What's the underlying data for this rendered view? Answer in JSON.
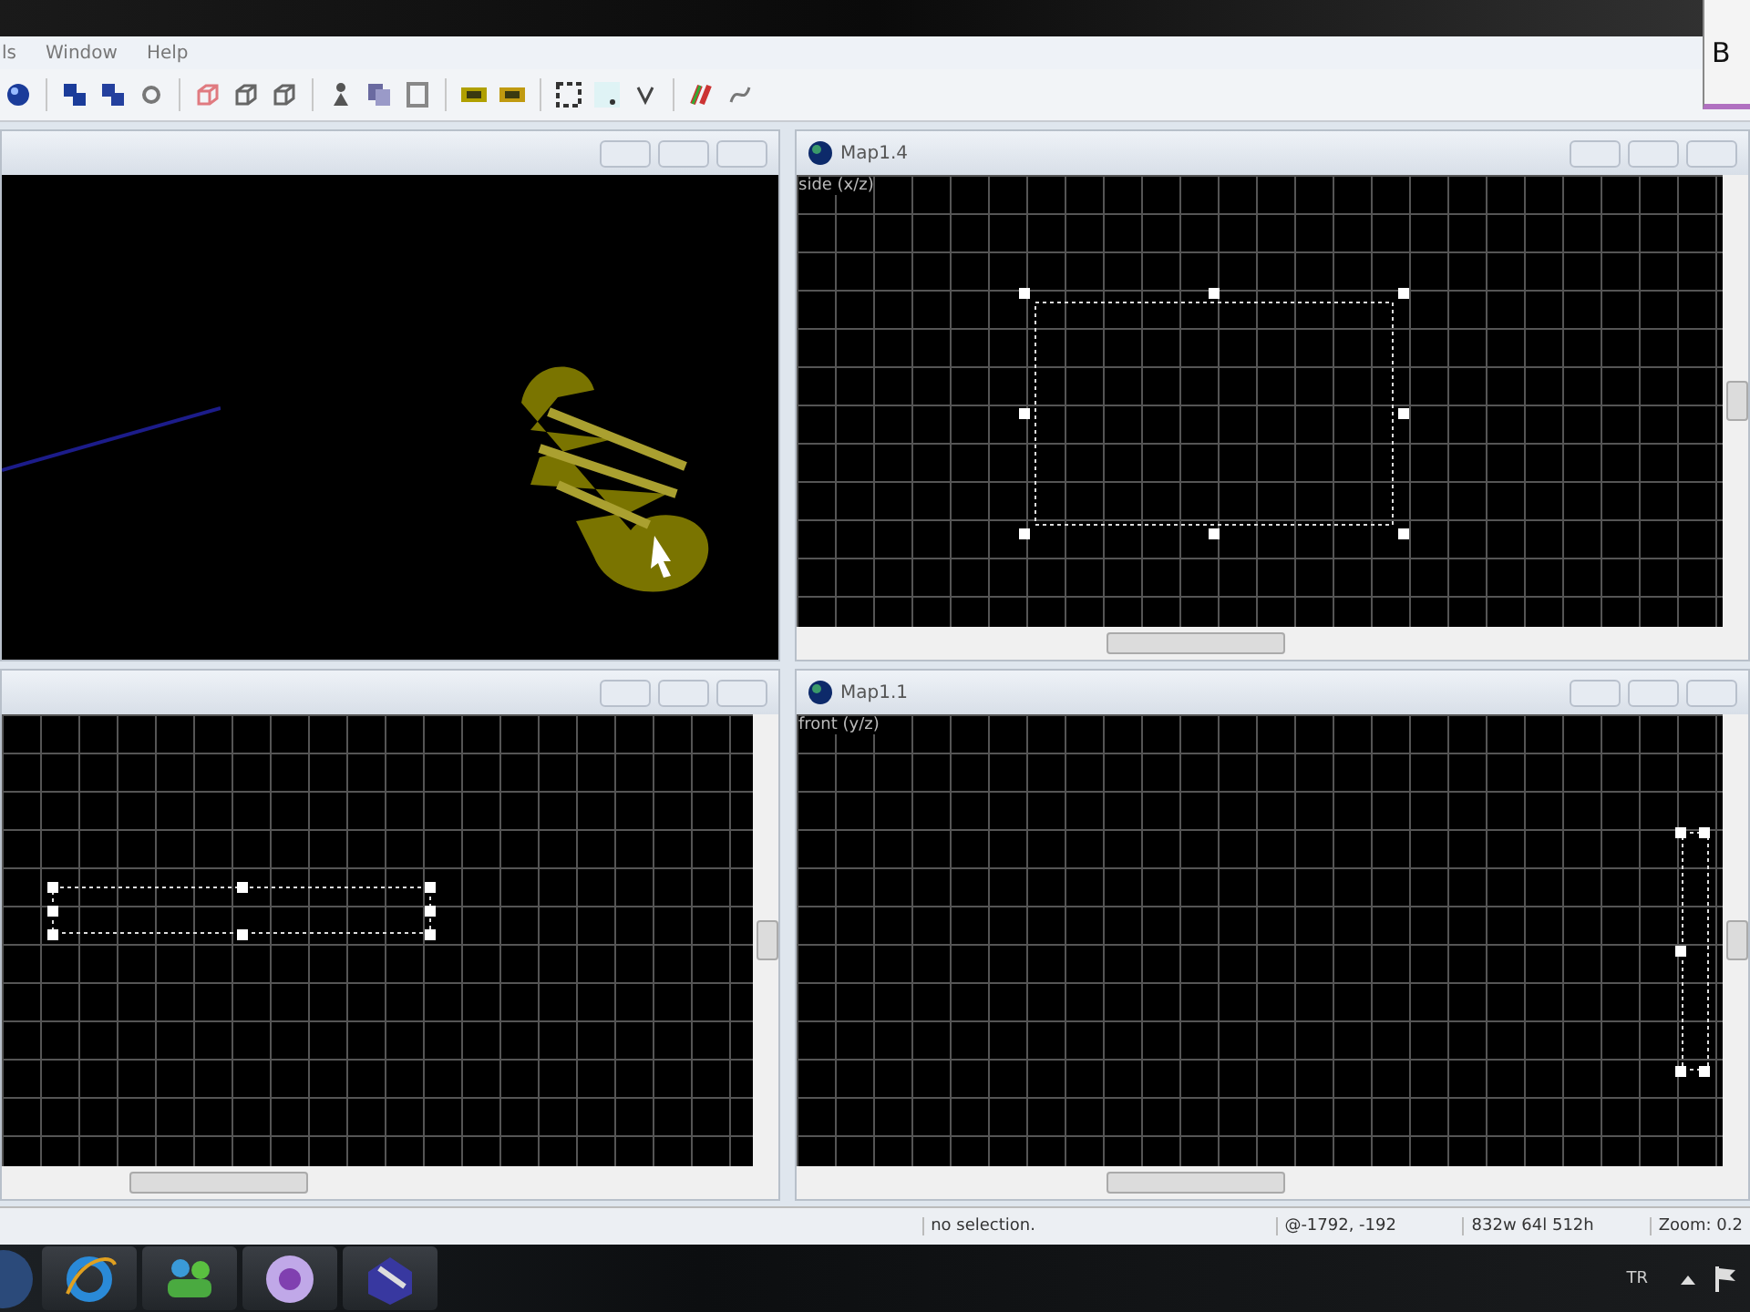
{
  "popup": {
    "text": "B"
  },
  "menu": [
    "ls",
    "Window",
    "Help"
  ],
  "viewports": [
    {
      "kind": "camera"
    },
    {
      "kind": "grid",
      "title": "Map1.4",
      "label": "side (x/z)"
    },
    {
      "kind": "grid"
    },
    {
      "kind": "grid",
      "title": "Map1.1",
      "label": "front (y/z)"
    }
  ],
  "status_bar": [
    "no selection.",
    "@-1792, -192",
    "832w 64l 512h",
    "Zoom: 0.2"
  ],
  "taskbar": {
    "language": "TR"
  }
}
